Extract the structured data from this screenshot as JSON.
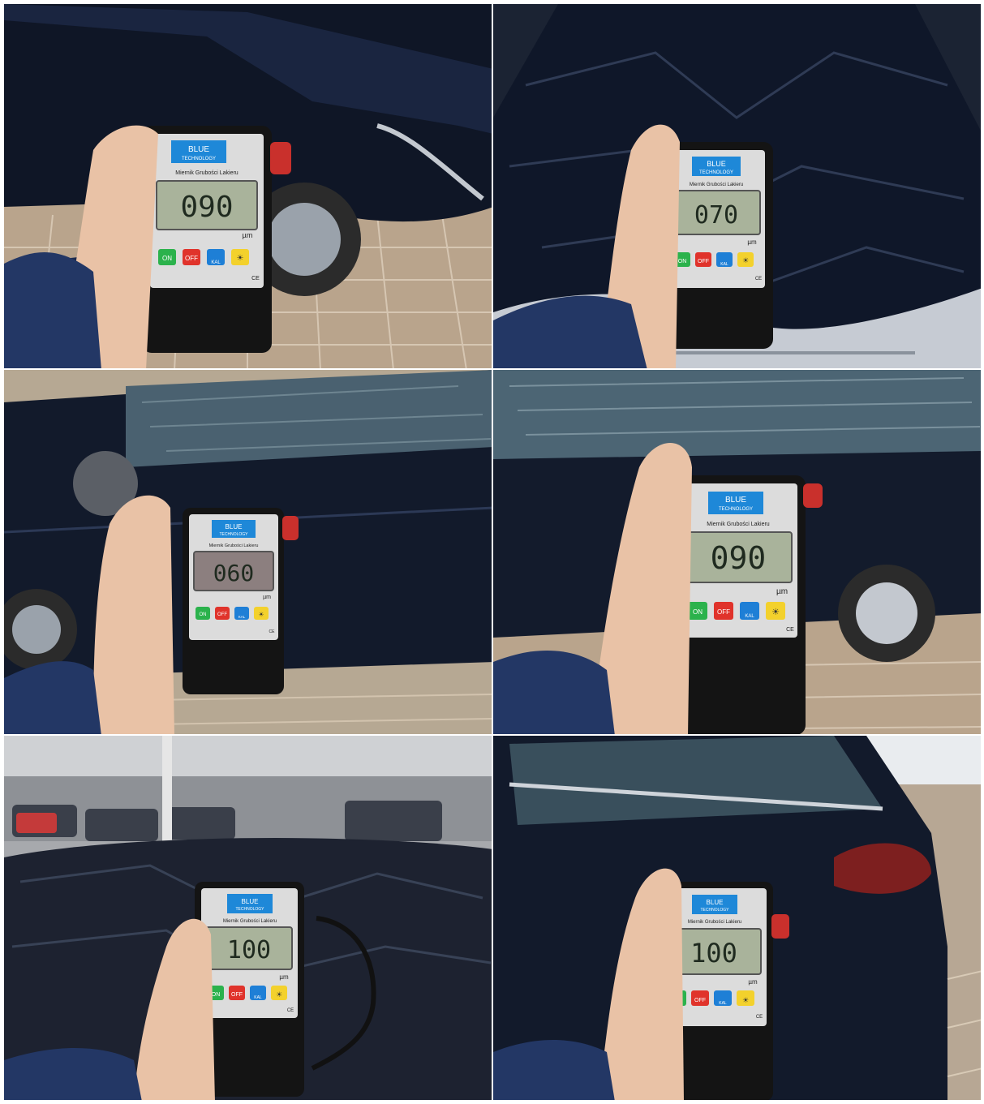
{
  "collage": {
    "photos": [
      {
        "scene": "door-panel",
        "reading": "090"
      },
      {
        "scene": "hood",
        "reading": "070"
      },
      {
        "scene": "front-door",
        "reading": "060"
      },
      {
        "scene": "rear-door",
        "reading": "090"
      },
      {
        "scene": "roof",
        "reading": "100"
      },
      {
        "scene": "rear-quarter",
        "reading": "100"
      }
    ]
  },
  "meter": {
    "brand_line1": "BLUE",
    "brand_line2": "TECHNOLOGY",
    "model_label": "Miernik Grubości Lakieru",
    "unit": "µm",
    "buttons": {
      "on": "ON",
      "off": "OFF",
      "kal": "KAL"
    },
    "ce_mark": "CE",
    "colors": {
      "body": "#141414",
      "faceplate": "#dcdcdc",
      "lcd": "#a9b39b",
      "lcd_digits": "#1f2a1f",
      "logo_blue": "#1e88d8",
      "btn_on": "#2bb24c",
      "btn_off": "#e0332b",
      "btn_kal": "#1e7fd6",
      "btn_light": "#f3d12c",
      "probe_red": "#c9302c"
    }
  }
}
